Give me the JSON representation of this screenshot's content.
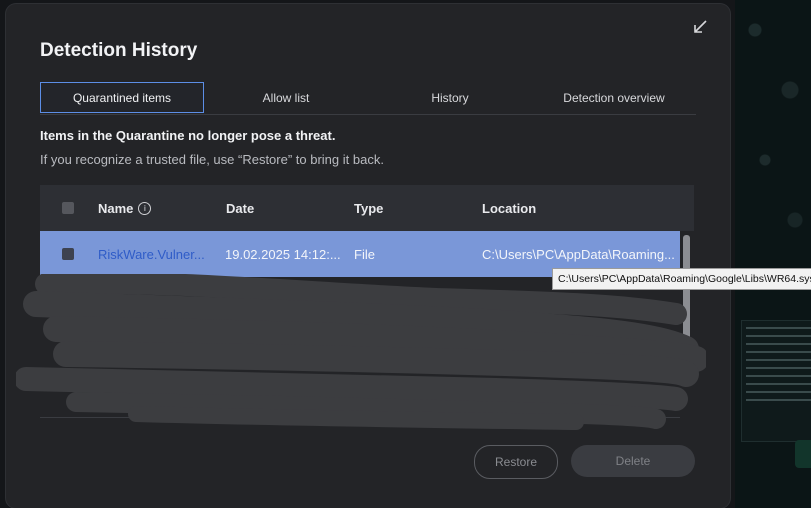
{
  "dialog": {
    "title": "Detection History",
    "tabs": [
      {
        "label": "Quarantined items",
        "active": true
      },
      {
        "label": "Allow list",
        "active": false
      },
      {
        "label": "History",
        "active": false
      },
      {
        "label": "Detection overview",
        "active": false
      }
    ],
    "info_bold": "Items in the Quarantine no longer pose a threat.",
    "info_text": "If you recognize a trusted file, use “Restore” to bring it back.",
    "table": {
      "headers": {
        "name": "Name",
        "date": "Date",
        "type": "Type",
        "location": "Location"
      },
      "rows": [
        {
          "name": "RiskWare.Vulner...",
          "date": "19.02.2025 14:12:...",
          "type": "File",
          "location": "C:\\Users\\PC\\AppData\\Roaming...",
          "selected": true
        }
      ]
    },
    "tooltip": "C:\\Users\\PC\\AppData\\Roaming\\Google\\Libs\\WR64.sys",
    "buttons": {
      "restore": "Restore",
      "delete": "Delete"
    }
  },
  "colors": {
    "dialog_bg": "#232427",
    "selected_row": "#7a97d8",
    "active_tab_border": "#5c8ee6",
    "link_blue": "#2f5cc8"
  }
}
